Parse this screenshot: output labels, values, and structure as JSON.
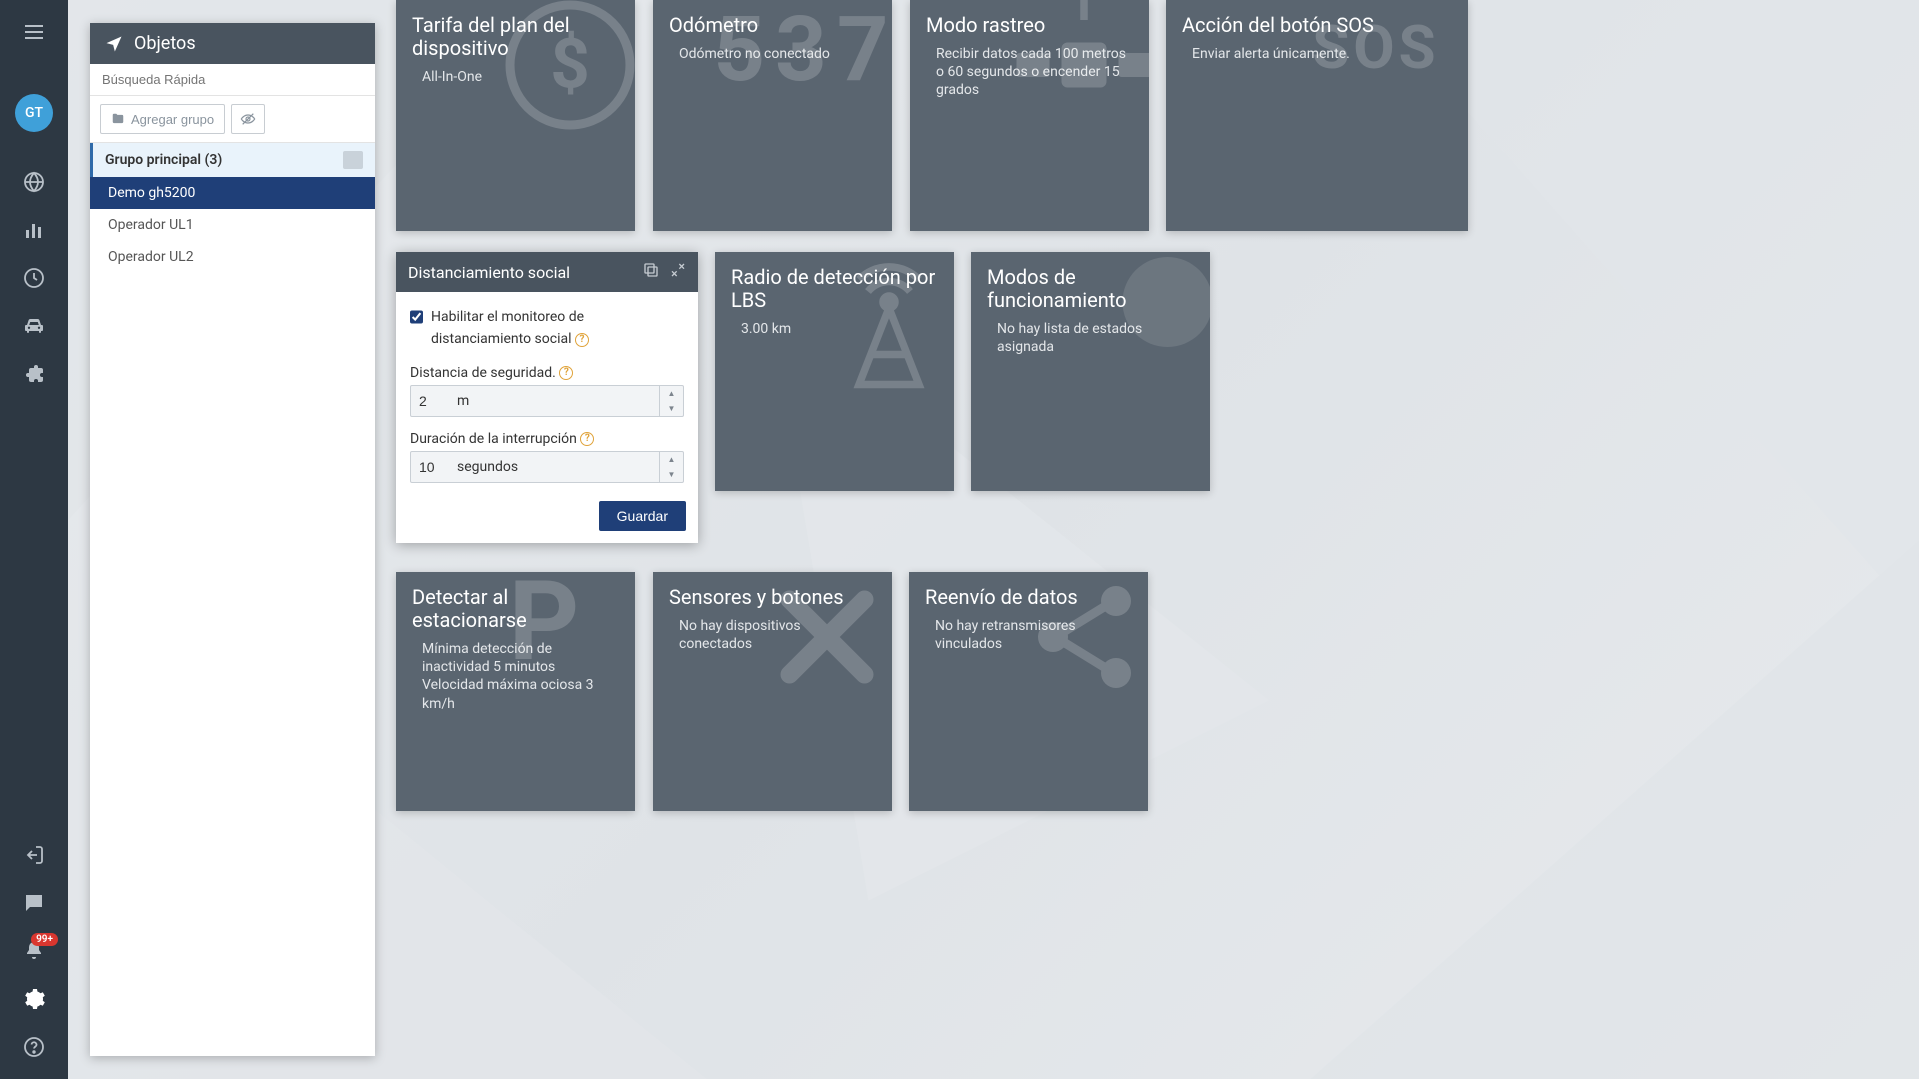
{
  "rail": {
    "avatar": "GT",
    "notification_count": "99+"
  },
  "objects_panel": {
    "title": "Objetos",
    "search_placeholder": "Búsqueda Rápida",
    "add_group_label": "Agregar grupo",
    "group_header": "Grupo principal (3)",
    "items": [
      {
        "label": "Demo gh5200",
        "selected": true
      },
      {
        "label": "Operador UL1",
        "selected": false
      },
      {
        "label": "Operador UL2",
        "selected": false
      }
    ]
  },
  "social_card": {
    "title": "Distanciamiento social",
    "enable_label": "Habilitar el monitoreo de distanciamiento social",
    "safety_label": "Distancia de seguridad.",
    "safety_value": "2",
    "safety_unit": "m",
    "duration_label": "Duración de la interrupción",
    "duration_value": "10",
    "duration_unit": "segundos",
    "save_label": "Guardar"
  },
  "tiles": {
    "plan": {
      "title": "Tarifa del plan del dispositivo",
      "sub": "All-In-One"
    },
    "odo": {
      "title": "Odómetro",
      "sub": "Odómetro no conectado"
    },
    "track": {
      "title": "Modo rastreo",
      "sub": "Recibir datos cada 100 metros o 60 segundos o encender 15 grados"
    },
    "sos": {
      "title": "Acción del botón SOS",
      "sub": "Enviar alerta únicamente."
    },
    "lbs": {
      "title": "Radio de detección por LBS",
      "sub": "3.00 km"
    },
    "modes": {
      "title": "Modos de funcionamiento",
      "sub": "No hay lista de estados asignada"
    },
    "park": {
      "title": "Detectar al estacionarse",
      "sub": "Mínima detección de inactividad 5 minutos Velocidad máxima ociosa 3 km/h"
    },
    "sensors": {
      "title": "Sensores y botones",
      "sub": "No hay dispositivos conectados"
    },
    "forward": {
      "title": "Reenvío de datos",
      "sub": "No hay retransmisores vinculados"
    }
  }
}
